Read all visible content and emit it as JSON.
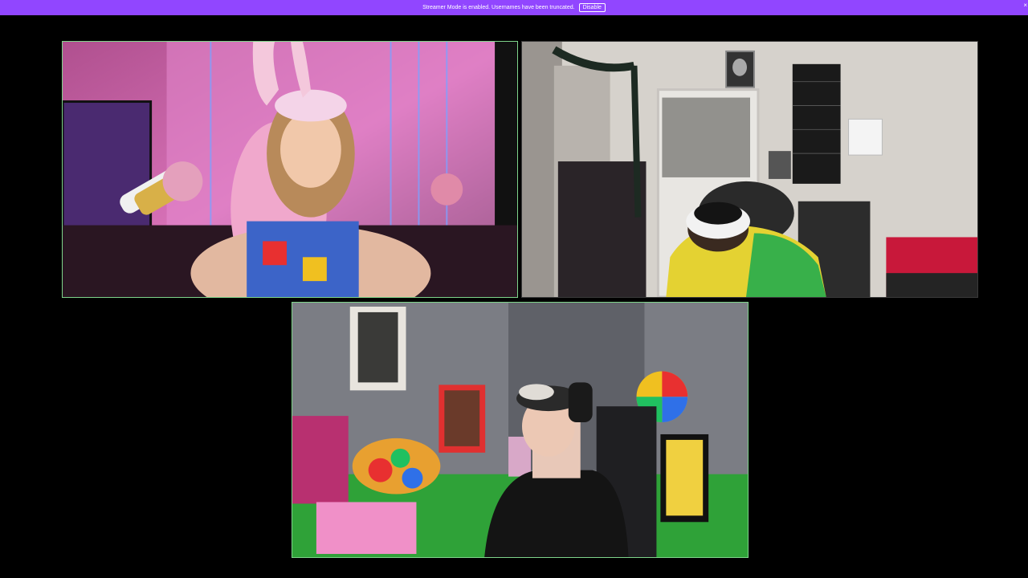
{
  "banner": {
    "message": "Streamer Mode is enabled. Usernames have been truncated.",
    "disable_label": "Disable",
    "close_glyph": "×",
    "color": "#9146ff"
  },
  "video_tiles": [
    {
      "active_speaker": true
    },
    {
      "active_speaker": false
    },
    {
      "active_speaker": true
    }
  ],
  "icons": [
    "close-icon"
  ]
}
